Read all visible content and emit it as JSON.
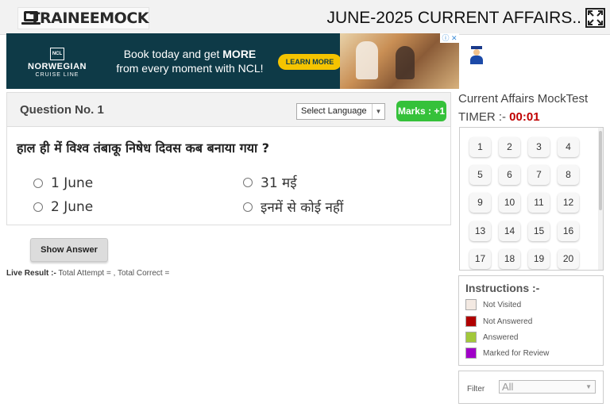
{
  "header": {
    "logo_text": "TRAINEEMOCK",
    "title": "JUNE-2025 CURRENT AFFAIRS.."
  },
  "ad": {
    "badge": "NCL",
    "brand": "NORWEGIAN",
    "brand_sub": "CRUISE LINE",
    "headline_part1": "Book today and get ",
    "headline_bold": "MORE",
    "headline_part2": "from every moment with NCL!",
    "cta": "LEARN MORE",
    "choices": "ⓘ ✕"
  },
  "question": {
    "number_label": "Question No. 1",
    "language_select": "Select Language",
    "marks": "Marks : +1",
    "text": "हाल ही में विश्व तंबाकू निषेध दिवस कब बनाया गया ?",
    "options": [
      "1 June",
      "31 मई",
      "2 June",
      "इनमें से कोई नहीं"
    ],
    "show_answer": "Show Answer",
    "live_result_label": "Live Result :-",
    "live_result_text": " Total Attempt = , Total Correct ="
  },
  "panel": {
    "title": "Current Affairs MockTest",
    "timer_label": "TIMER :-",
    "timer_value": "00:01",
    "question_numbers": [
      "1",
      "2",
      "3",
      "4",
      "5",
      "6",
      "7",
      "8",
      "9",
      "10",
      "11",
      "12",
      "13",
      "14",
      "15",
      "16",
      "17",
      "18",
      "19",
      "20"
    ],
    "instructions_title": "Instructions :-",
    "legend": [
      {
        "label": "Not Visited",
        "color": "#f3e9e2"
      },
      {
        "label": "Not Answered",
        "color": "#b00000"
      },
      {
        "label": "Answered",
        "color": "#a2c83a"
      },
      {
        "label": "Marked for Review",
        "color": "#a000c8"
      }
    ],
    "filter_label": "Filter",
    "filter_value": "All"
  }
}
